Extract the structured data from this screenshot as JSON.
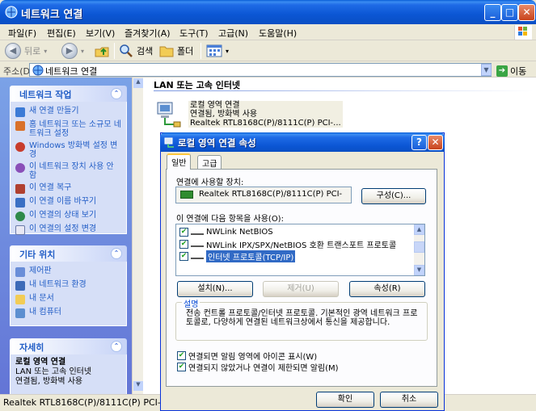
{
  "window": {
    "title": "네트워크 연결",
    "minimize": "_",
    "maximize": "□",
    "close": "✕"
  },
  "menu": [
    "파일(F)",
    "편집(E)",
    "보기(V)",
    "즐겨찾기(A)",
    "도구(T)",
    "고급(N)",
    "도움말(H)"
  ],
  "toolbar": {
    "back": "뒤로",
    "search": "검색",
    "folders": "폴더"
  },
  "address": {
    "label": "주소(D)",
    "value": "네트워크 연결",
    "go": "이동"
  },
  "taskpane": {
    "network_tasks": {
      "title": "네트워크 작업",
      "items": [
        "새 연결 만들기",
        "홈 네트워크 또는 소규모 네트워크 설정",
        "Windows 방화벽 설정 변경",
        "이 네트워크 장치 사용 안 함",
        "이 연결 복구",
        "이 연결 이름 바꾸기",
        "이 연결의 상태 보기",
        "이 연결의 설정 변경"
      ]
    },
    "other_places": {
      "title": "기타 위치",
      "items": [
        "제어판",
        "내 네트워크 환경",
        "내 문서",
        "내 컴퓨터"
      ]
    },
    "details": {
      "title": "자세히",
      "name": "로컬 영역 연결",
      "line1": "LAN 또는 고속 인터넷",
      "line2": "연결됨, 방화벽 사용"
    }
  },
  "content": {
    "group_title": "LAN 또는 고속 인터넷",
    "connection": {
      "name": "로컬 영역 연결",
      "status": "연결됨, 방화벽 사용",
      "device": "Realtek RTL8168C(P)/8111C(P) PCI-..."
    }
  },
  "statusbar": {
    "text": "Realtek RTL8168C(P)/8111C(P) PCI-E Gi"
  },
  "dialog": {
    "title": "로컬 영역 연결 속성",
    "help": "?",
    "close": "✕",
    "tabs": [
      "일반",
      "고급"
    ],
    "connect_using_label": "연결에 사용할 장치:",
    "device": "Realtek RTL8168C(P)/8111C(P) PCI-",
    "configure": "구성(C)...",
    "items_label": "이 연결에 다음 항목을 사용(O):",
    "items": [
      {
        "label": "NWLink NetBIOS",
        "checked": true
      },
      {
        "label": "NWLink IPX/SPX/NetBIOS 호환 트랜스포트 프로토콜",
        "checked": true
      },
      {
        "label": "인터넷 프로토콜(TCP/IP)",
        "checked": true
      }
    ],
    "install": "설치(N)...",
    "uninstall": "제거(U)",
    "properties": "속성(R)",
    "description_label": "설명",
    "description": "전송 컨트롤 프로토콜/인터넷 프로토콜. 기본적인 광역 네트워크 프로토콜로, 다양하게 연결된 네트워크상에서 통신을 제공합니다.",
    "show_icon": "연결되면 알림 영역에 아이콘 표시(W)",
    "notify_limited": "연결되지 않았거나 연결이 제한되면 알림(M)",
    "ok": "확인",
    "cancel": "취소"
  }
}
